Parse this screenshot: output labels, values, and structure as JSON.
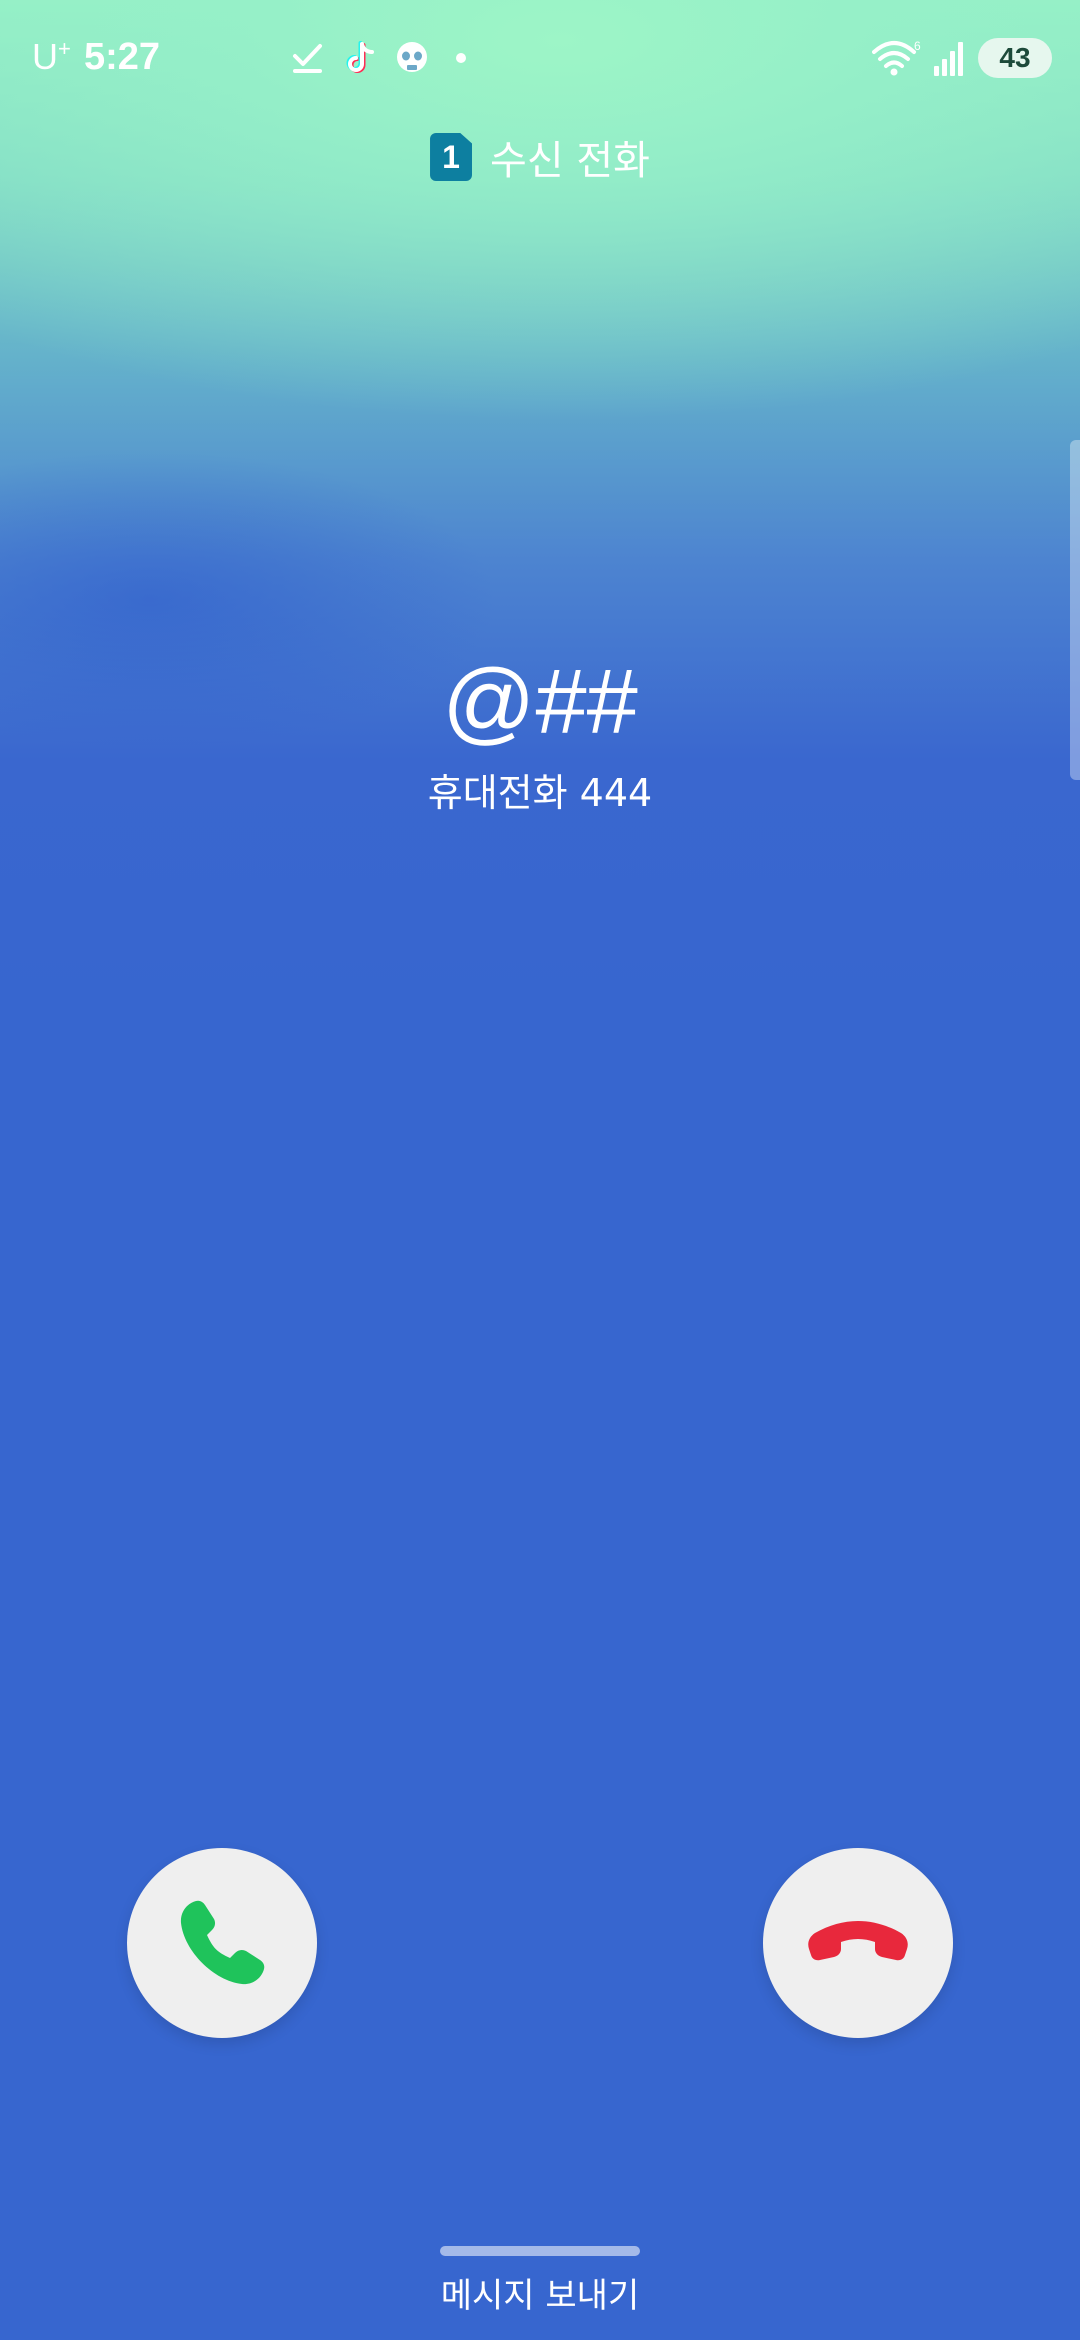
{
  "status_bar": {
    "carrier": "U",
    "carrier_sup": "+",
    "time": "5:27",
    "notification_icons": [
      "checkmark-icon",
      "tiktok-icon",
      "skull-icon"
    ],
    "wifi_label": "6",
    "battery": "43"
  },
  "header": {
    "sim_number": "1",
    "label": "수신 전화"
  },
  "caller": {
    "name": "@##",
    "subtitle": "휴대전화 444"
  },
  "actions": {
    "accept_icon": "phone-icon",
    "decline_icon": "hang-up-icon",
    "accept_color": "#1fc35b",
    "decline_color": "#e8283c"
  },
  "bottom": {
    "send_message": "메시지 보내기"
  }
}
